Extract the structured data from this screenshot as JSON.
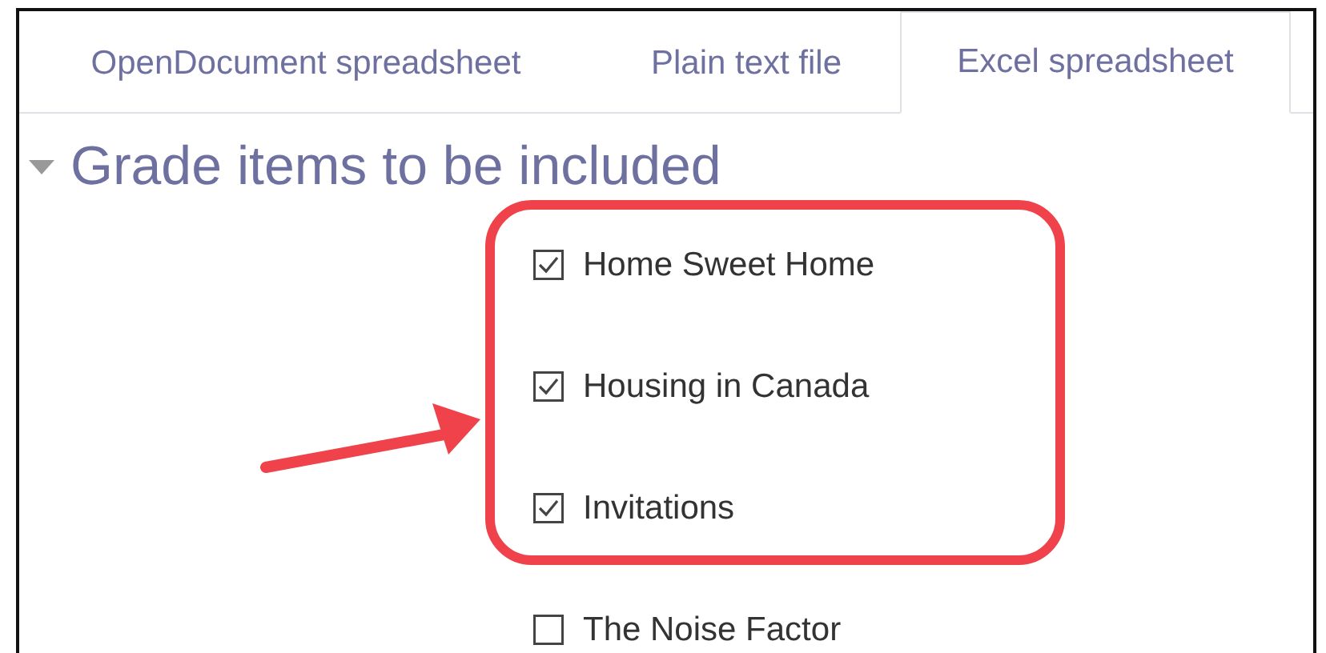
{
  "tabs": [
    {
      "label": "OpenDocument spreadsheet",
      "selected": false
    },
    {
      "label": "Plain text file",
      "selected": false
    },
    {
      "label": "Excel spreadsheet",
      "selected": true
    }
  ],
  "section": {
    "title": "Grade items to be included",
    "expanded": true
  },
  "items": [
    {
      "label": "Home Sweet Home",
      "checked": true
    },
    {
      "label": "Housing in Canada",
      "checked": true
    },
    {
      "label": "Invitations",
      "checked": true
    },
    {
      "label": "The Noise Factor",
      "checked": false
    }
  ]
}
